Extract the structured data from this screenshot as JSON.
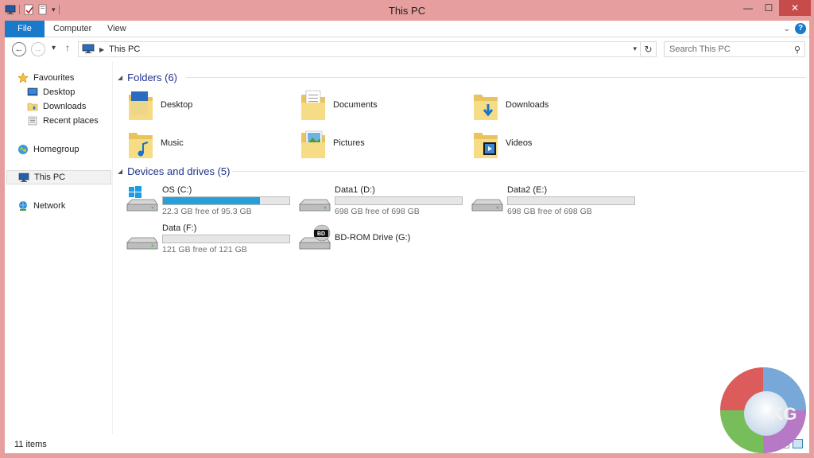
{
  "window": {
    "title": "This PC",
    "controls": {
      "minimize": "—",
      "maximize": "☐",
      "close": "✕"
    }
  },
  "ribbon": {
    "tabs": [
      {
        "label": "File",
        "active": true
      },
      {
        "label": "Computer"
      },
      {
        "label": "View"
      }
    ]
  },
  "address": {
    "crumb": "This PC",
    "search_placeholder": "Search This PC"
  },
  "navigation": {
    "items": [
      {
        "label": "Favourites",
        "icon": "star-icon",
        "level": 0
      },
      {
        "label": "Desktop",
        "icon": "desktop-icon",
        "level": 1
      },
      {
        "label": "Downloads",
        "icon": "downloads-folder-icon",
        "level": 1
      },
      {
        "label": "Recent places",
        "icon": "recent-places-icon",
        "level": 1
      },
      {
        "label": "Homegroup",
        "icon": "homegroup-icon",
        "level": 0
      },
      {
        "label": "This PC",
        "icon": "computer-icon",
        "level": 0,
        "selected": true
      },
      {
        "label": "Network",
        "icon": "network-icon",
        "level": 0
      }
    ]
  },
  "folders": {
    "heading": "Folders (6)",
    "items": [
      {
        "label": "Desktop",
        "icon": "desktop-folder-icon"
      },
      {
        "label": "Documents",
        "icon": "documents-folder-icon"
      },
      {
        "label": "Downloads",
        "icon": "downloads-folder-icon"
      },
      {
        "label": "Music",
        "icon": "music-folder-icon"
      },
      {
        "label": "Pictures",
        "icon": "pictures-folder-icon"
      },
      {
        "label": "Videos",
        "icon": "videos-folder-icon"
      }
    ]
  },
  "drives": {
    "heading": "Devices and drives (5)",
    "items": [
      {
        "name": "OS (C:)",
        "free": "22.3 GB free of 95.3 GB",
        "used_fraction": 0.766,
        "icon": "windows-drive-icon"
      },
      {
        "name": "Data1 (D:)",
        "free": "698 GB free of 698 GB",
        "used_fraction": 0.0,
        "icon": "hard-drive-icon"
      },
      {
        "name": "Data2 (E:)",
        "free": "698 GB free of 698 GB",
        "used_fraction": 0.0,
        "icon": "hard-drive-icon"
      },
      {
        "name": "Data (F:)",
        "free": "121 GB free of 121 GB",
        "used_fraction": 0.0,
        "icon": "hard-drive-icon"
      },
      {
        "name": "BD-ROM Drive (G:)",
        "icon": "bd-rom-drive-icon"
      }
    ]
  },
  "status": {
    "item_count": "11 items"
  },
  "watermark": {
    "text": "KG"
  },
  "colors": {
    "title_bar": "#e69e9e",
    "accent": "#1979ca",
    "group_heading": "#1e3287",
    "usage_bar": "#26a0da",
    "close_button": "#c74b4b"
  }
}
